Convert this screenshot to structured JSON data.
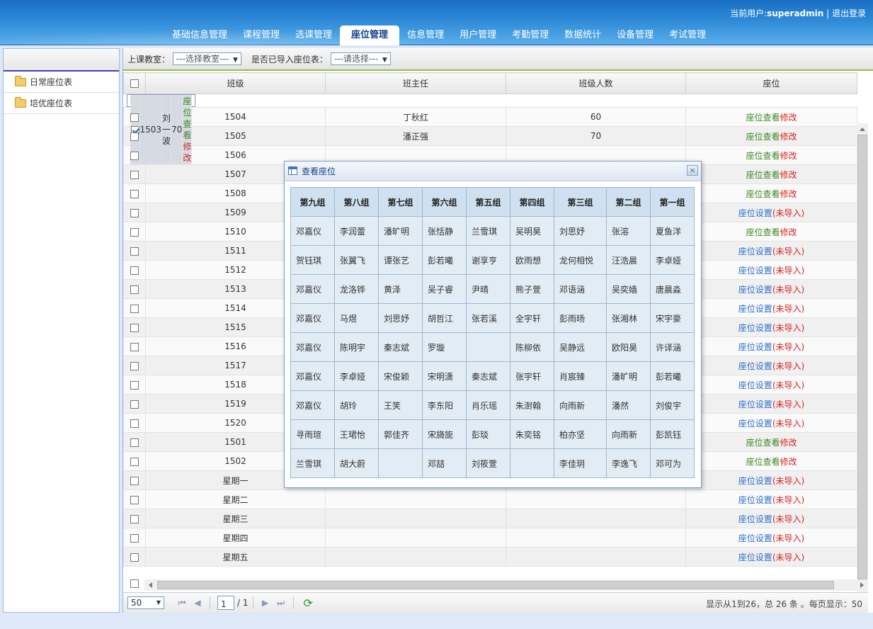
{
  "header": {
    "user_prefix": "当前用户:",
    "user_name": "superadmin",
    "separator": " | ",
    "logout": "退出登录",
    "nav": [
      "基础信息管理",
      "课程管理",
      "选课管理",
      "座位管理",
      "信息管理",
      "用户管理",
      "考勤管理",
      "数据统计",
      "设备管理",
      "考试管理"
    ],
    "active_nav": "座位管理"
  },
  "sidebar": {
    "items": [
      {
        "label": "日常座位表",
        "icon": "folder-icon"
      },
      {
        "label": "培优座位表",
        "icon": "folder-icon"
      }
    ]
  },
  "toolbar": {
    "classroom_label": "上课教室：",
    "classroom_select": "---选择教室---",
    "imported_label": "是否已导入座位表：",
    "imported_select": "---请选择---"
  },
  "grid": {
    "columns": [
      "班级",
      "班主任",
      "班级人数",
      "座位"
    ],
    "link_view": "座位查看",
    "link_edit": "修改",
    "link_setup": "座位设置",
    "link_not_imported": "(未导入)",
    "rows": [
      {
        "cls": "1503",
        "teacher": "刘一波",
        "count": "70",
        "mode": "view",
        "checked": true
      },
      {
        "cls": "1504",
        "teacher": "丁秋红",
        "count": "60",
        "mode": "view"
      },
      {
        "cls": "1505",
        "teacher": "潘正强",
        "count": "70",
        "mode": "view"
      },
      {
        "cls": "1506",
        "teacher": "",
        "count": "",
        "mode": "view"
      },
      {
        "cls": "1507",
        "teacher": "",
        "count": "",
        "mode": "view"
      },
      {
        "cls": "1508",
        "teacher": "",
        "count": "",
        "mode": "view"
      },
      {
        "cls": "1509",
        "teacher": "",
        "count": "",
        "mode": "setup"
      },
      {
        "cls": "1510",
        "teacher": "",
        "count": "",
        "mode": "view"
      },
      {
        "cls": "1511",
        "teacher": "",
        "count": "",
        "mode": "setup"
      },
      {
        "cls": "1512",
        "teacher": "",
        "count": "",
        "mode": "setup"
      },
      {
        "cls": "1513",
        "teacher": "",
        "count": "",
        "mode": "setup"
      },
      {
        "cls": "1514",
        "teacher": "",
        "count": "",
        "mode": "setup"
      },
      {
        "cls": "1515",
        "teacher": "",
        "count": "",
        "mode": "setup"
      },
      {
        "cls": "1516",
        "teacher": "",
        "count": "",
        "mode": "setup"
      },
      {
        "cls": "1517",
        "teacher": "",
        "count": "",
        "mode": "setup"
      },
      {
        "cls": "1518",
        "teacher": "",
        "count": "",
        "mode": "setup"
      },
      {
        "cls": "1519",
        "teacher": "",
        "count": "",
        "mode": "setup"
      },
      {
        "cls": "1520",
        "teacher": "",
        "count": "",
        "mode": "setup"
      },
      {
        "cls": "1501",
        "teacher": "",
        "count": "",
        "mode": "view"
      },
      {
        "cls": "1502",
        "teacher": "",
        "count": "",
        "mode": "view"
      },
      {
        "cls": "星期一",
        "teacher": "",
        "count": "",
        "mode": "setup"
      },
      {
        "cls": "星期二",
        "teacher": "",
        "count": "",
        "mode": "setup"
      },
      {
        "cls": "星期三",
        "teacher": "",
        "count": "",
        "mode": "setup"
      },
      {
        "cls": "星期四",
        "teacher": "",
        "count": "",
        "mode": "setup"
      },
      {
        "cls": "星期五",
        "teacher": "",
        "count": "",
        "mode": "setup"
      }
    ]
  },
  "pager": {
    "page_size": "50",
    "page": "1",
    "page_total": "/ 1",
    "info": "显示从1到26，总 26 条 。每页显示：50"
  },
  "dialog": {
    "title": "查看座位",
    "close": "×",
    "groups": [
      "第九组",
      "第八组",
      "第七组",
      "第六组",
      "第五组",
      "第四组",
      "第三组",
      "第二组",
      "第一组"
    ],
    "rows": [
      [
        "邓嘉仪",
        "李润蕾",
        "潘旷明",
        "张恬静",
        "兰雪琪",
        "吴明昊",
        "刘思妤",
        "张溶",
        "夏鱼洋"
      ],
      [
        "贺钰琪",
        "张翼飞",
        "谭张艺",
        "彭若曦",
        "谢享亨",
        "欧雨想",
        "龙何相悦",
        "汪浩晨",
        "李卓娅"
      ],
      [
        "邓嘉仪",
        "龙洛铧",
        "黄泽",
        "吴子睿",
        "尹晴",
        "熊子萱",
        "邓语涵",
        "吴奕嫱",
        "唐晨淼"
      ],
      [
        "邓嘉仪",
        "马煜",
        "刘思妤",
        "胡哲江",
        "张若溪",
        "全宇轩",
        "彭雨旸",
        "张湘林",
        "宋宇豪"
      ],
      [
        "邓嘉仪",
        "陈明宇",
        "秦志斌",
        "罗璇",
        "",
        "陈柳依",
        "吴静远",
        "欧阳昊",
        "许译涵"
      ],
      [
        "邓嘉仪",
        "李卓娅",
        "宋俊颖",
        "宋明潇",
        "秦志斌",
        "张宇轩",
        "肖宸臻",
        "潘旷明",
        "彭若曦"
      ],
      [
        "邓嘉仪",
        "胡玲",
        "王笑",
        "李东阳",
        "肖乐瑶",
        "朱澍翰",
        "向雨新",
        "潘然",
        "刘俊宇"
      ],
      [
        "寻雨瑄",
        "王珺怡",
        "郭佳齐",
        "宋旖旎",
        "彭琰",
        "朱奕铭",
        "柏亦坚",
        "向雨新",
        "彭凯钰"
      ],
      [
        "兰雪琪",
        "胡大蔚",
        "",
        "邓喆",
        "刘筱萱",
        "",
        "李佳玥",
        "李逸飞",
        "邓可为"
      ]
    ]
  }
}
